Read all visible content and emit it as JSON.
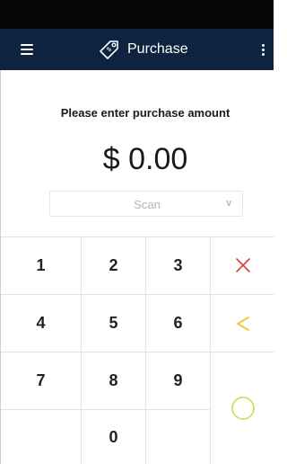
{
  "app_bar": {
    "title": "Purchase",
    "menu_icon": "hamburger-menu-icon",
    "tag_icon": "price-tag-icon",
    "more_icon": "more-vertical-icon",
    "background": "#0d2340"
  },
  "main": {
    "prompt": "Please enter purchase amount",
    "amount": "$ 0.00",
    "scan_select": {
      "value": "Scan",
      "chevron": "v"
    }
  },
  "keypad": {
    "keys": {
      "k1": "1",
      "k2": "2",
      "k3": "3",
      "k4": "4",
      "k5": "5",
      "k6": "6",
      "k7": "7",
      "k8": "8",
      "k9": "9",
      "k0": "0"
    },
    "clear_icon": "clear-x-icon",
    "backspace_icon": "backspace-chevron-icon",
    "enter_icon": "enter-circle-icon",
    "colors": {
      "clear": "#e0403a",
      "backspace": "#f2c21b",
      "enter": "#c9d94a"
    }
  }
}
